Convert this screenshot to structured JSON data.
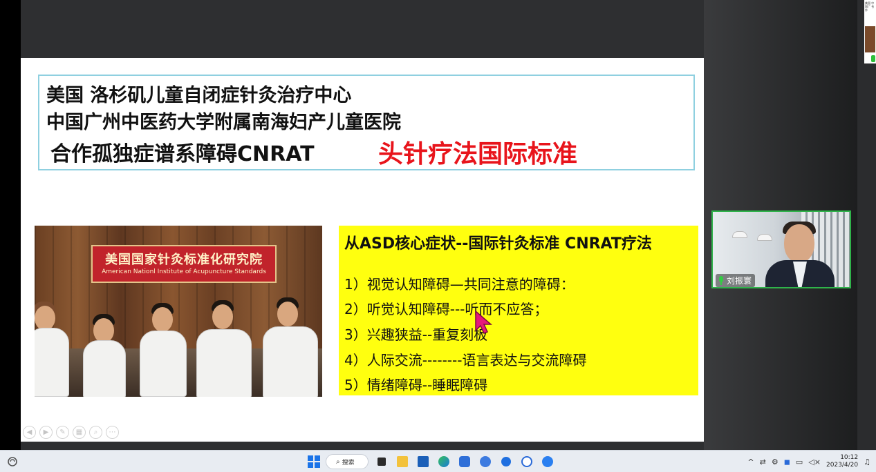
{
  "slide": {
    "title_line1": "美国 洛杉矶儿童自闭症针灸治疗中心",
    "title_line2": "中国广州中医药大学附属南海妇产儿童医院",
    "title_line3": "合作孤独症谱系障碍CNRAT",
    "title_line3_red": "头针疗法国际标准",
    "photo_banner_cn": "美国国家针灸标准化研究院",
    "photo_banner_en": "American Nationl Institute of Acupuncture Standards",
    "panel_heading": "从ASD核心症状--国际针灸标准 CNRAT疗法",
    "panel_items": [
      "1）视觉认知障碍—共同注意的障碍：",
      "2）听觉认知障碍---听而不应答；",
      "3）兴趣狭益--重复刻板",
      "4）人际交流--------语言表达与交流障碍",
      "5）情绪障碍--睡眠障碍"
    ],
    "panel_color": "#ffff0f",
    "title_red_color": "#e8141b"
  },
  "video_tile": {
    "participant_name": "刘振寰",
    "mic_icon": "mic-icon",
    "border_color": "#2fb34a"
  },
  "thumbnail": {
    "text": "美国 中国广 合作"
  },
  "taskbar": {
    "search_label": "搜索",
    "search_icon": "⌕",
    "tray_chevron": "^",
    "tray_volume": "◁×",
    "time": "10:12",
    "date": "2023/4/20"
  }
}
